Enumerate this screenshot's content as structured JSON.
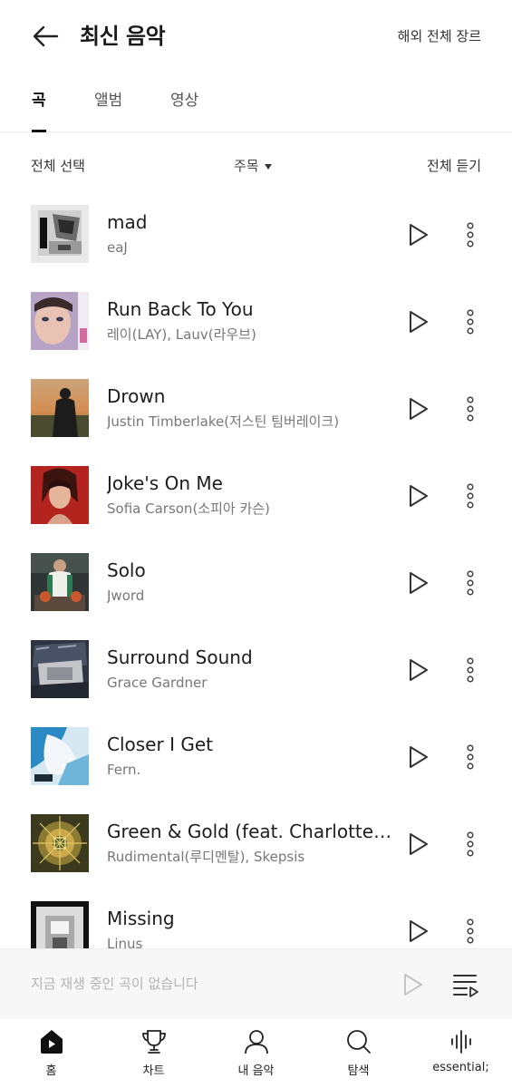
{
  "header": {
    "title": "최신 음악",
    "genre_link": "해외 전체 장르"
  },
  "tabs": [
    {
      "label": "곡",
      "active": true
    },
    {
      "label": "앨범",
      "active": false
    },
    {
      "label": "영상",
      "active": false
    }
  ],
  "toolbar": {
    "select_all": "전체 선택",
    "sort": "주목",
    "listen_all": "전체 듣기"
  },
  "songs": [
    {
      "title": "mad",
      "artist": "eaJ"
    },
    {
      "title": "Run Back To You",
      "artist": "레이(LAY), Lauv(라우브)"
    },
    {
      "title": "Drown",
      "artist": "Justin Timberlake(저스틴 팀버레이크)"
    },
    {
      "title": "Joke's On Me",
      "artist": "Sofia Carson(소피아 카슨)"
    },
    {
      "title": "Solo",
      "artist": "Jword"
    },
    {
      "title": "Surround Sound",
      "artist": "Grace Gardner"
    },
    {
      "title": "Closer I Get",
      "artist": "Fern."
    },
    {
      "title": "Green & Gold (feat. Charlotte P…",
      "artist": "Rudimental(루디멘탈), Skepsis"
    },
    {
      "title": "Missing",
      "artist": "Linus"
    }
  ],
  "mini_player": {
    "status_text": "지금 재생 중인 곡이 없습니다"
  },
  "bottom_nav": [
    {
      "label": "홈",
      "icon": "home-icon",
      "active": true
    },
    {
      "label": "차트",
      "icon": "trophy-icon",
      "active": false
    },
    {
      "label": "내 음악",
      "icon": "user-icon",
      "active": false
    },
    {
      "label": "탐색",
      "icon": "search-icon",
      "active": false
    },
    {
      "label": "essential;",
      "icon": "soundwave-icon",
      "active": false
    }
  ],
  "colors": {
    "text_primary": "#1d1d1d",
    "text_secondary": "#777777",
    "mini_player_bg": "#f7f7f7",
    "mini_player_text": "#b3b3b3"
  }
}
